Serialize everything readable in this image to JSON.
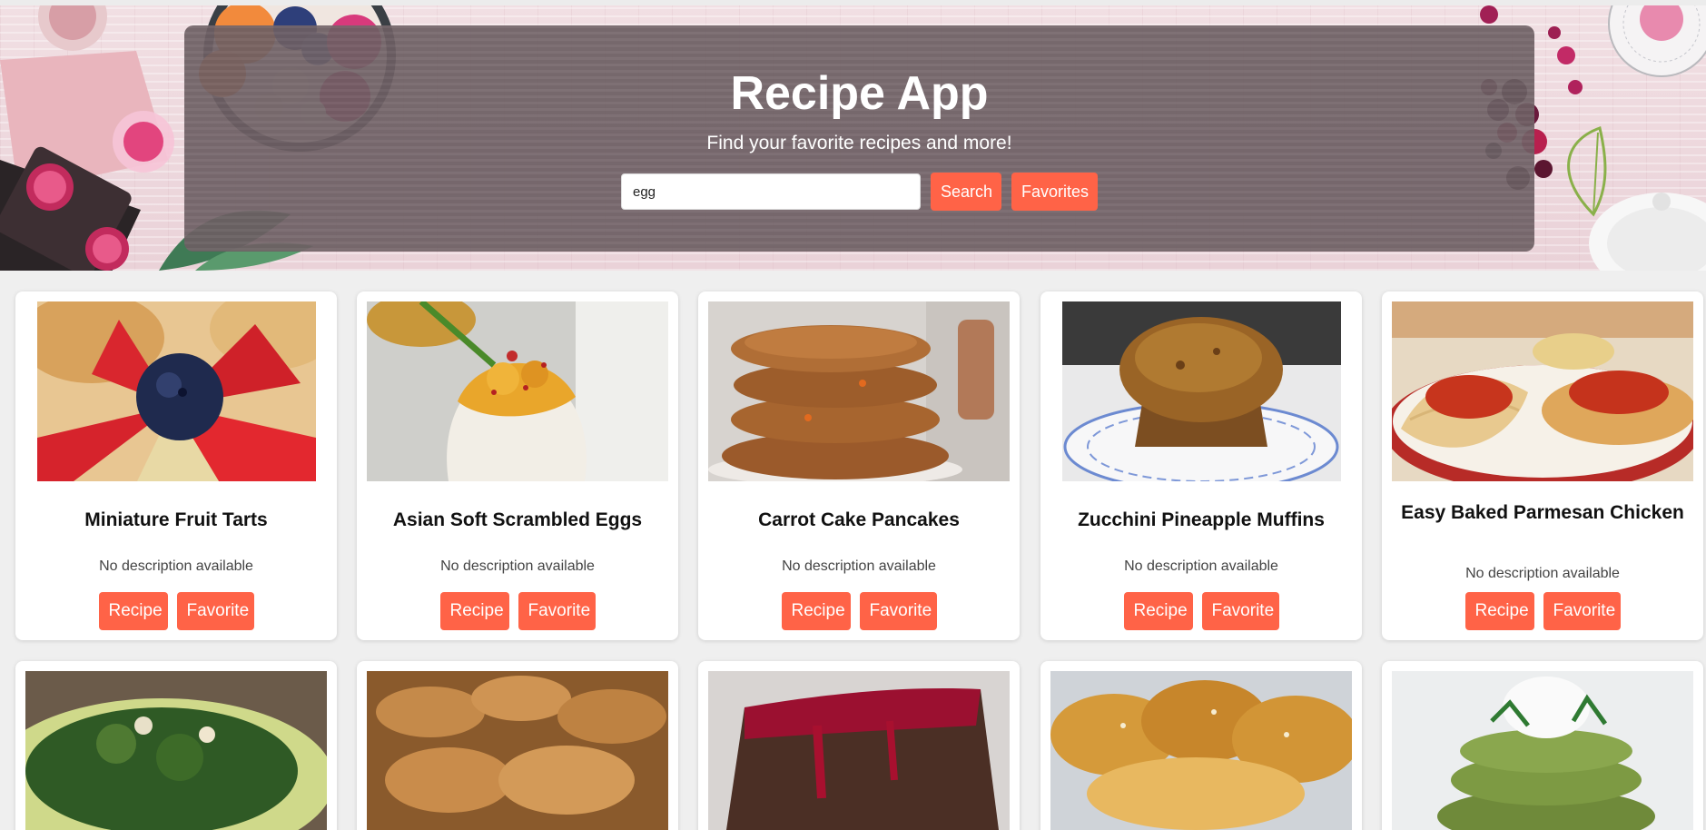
{
  "header": {
    "title": "Recipe App",
    "subtitle": "Find your favorite recipes and more!",
    "search": {
      "value": "egg"
    },
    "search_button": "Search",
    "favorites_button": "Favorites"
  },
  "colors": {
    "accent": "#ff6347",
    "panel": "#706266",
    "background": "#efefef"
  },
  "recipes": [
    {
      "title": "Miniature Fruit Tarts",
      "description": "No description available",
      "recipe_label": "Recipe",
      "favorite_label": "Favorite"
    },
    {
      "title": "Asian Soft Scrambled Eggs",
      "description": "No description available",
      "recipe_label": "Recipe",
      "favorite_label": "Favorite"
    },
    {
      "title": "Carrot Cake Pancakes",
      "description": "No description available",
      "recipe_label": "Recipe",
      "favorite_label": "Favorite"
    },
    {
      "title": "Zucchini Pineapple Muffins",
      "description": "No description available",
      "recipe_label": "Recipe",
      "favorite_label": "Favorite"
    },
    {
      "title": "Easy Baked Parmesan Chicken",
      "description": "No description available",
      "recipe_label": "Recipe",
      "favorite_label": "Favorite"
    }
  ]
}
